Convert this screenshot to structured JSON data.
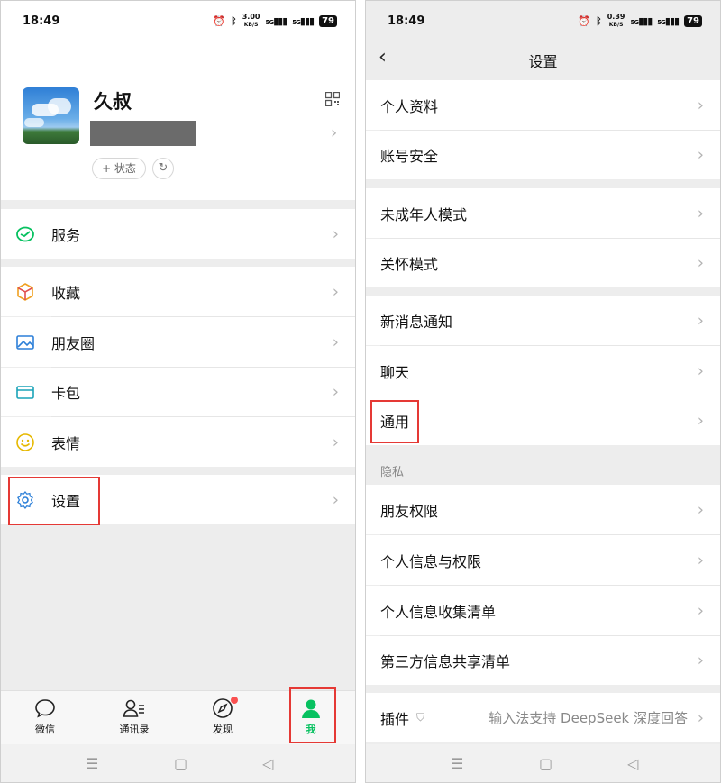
{
  "status": {
    "time": "18:49",
    "speed_left": "3.00",
    "speed_right": "0.39",
    "speed_unit": "KB/S",
    "network": "5G",
    "battery": "79"
  },
  "left": {
    "profile": {
      "name": "久叔",
      "status_button": "+ 状态"
    },
    "menu": [
      {
        "label": "服务"
      },
      {
        "label": "收藏"
      },
      {
        "label": "朋友圈"
      },
      {
        "label": "卡包"
      },
      {
        "label": "表情"
      },
      {
        "label": "设置"
      }
    ],
    "tabs": [
      {
        "label": "微信"
      },
      {
        "label": "通讯录"
      },
      {
        "label": "发现"
      },
      {
        "label": "我"
      }
    ]
  },
  "right": {
    "title": "设置",
    "items": [
      {
        "label": "个人资料"
      },
      {
        "label": "账号安全"
      },
      {
        "label": "未成年人模式"
      },
      {
        "label": "关怀模式"
      },
      {
        "label": "新消息通知"
      },
      {
        "label": "聊天"
      },
      {
        "label": "通用"
      },
      {
        "label": "朋友权限"
      },
      {
        "label": "个人信息与权限"
      },
      {
        "label": "个人信息收集清单"
      },
      {
        "label": "第三方信息共享清单"
      }
    ],
    "privacy_header": "隐私",
    "plugin": {
      "label": "插件",
      "value": "输入法支持 DeepSeek 深度回答"
    }
  },
  "colors": {
    "accent": "#07c160",
    "highlight_box": "#e53935",
    "badge": "#fa5151"
  }
}
